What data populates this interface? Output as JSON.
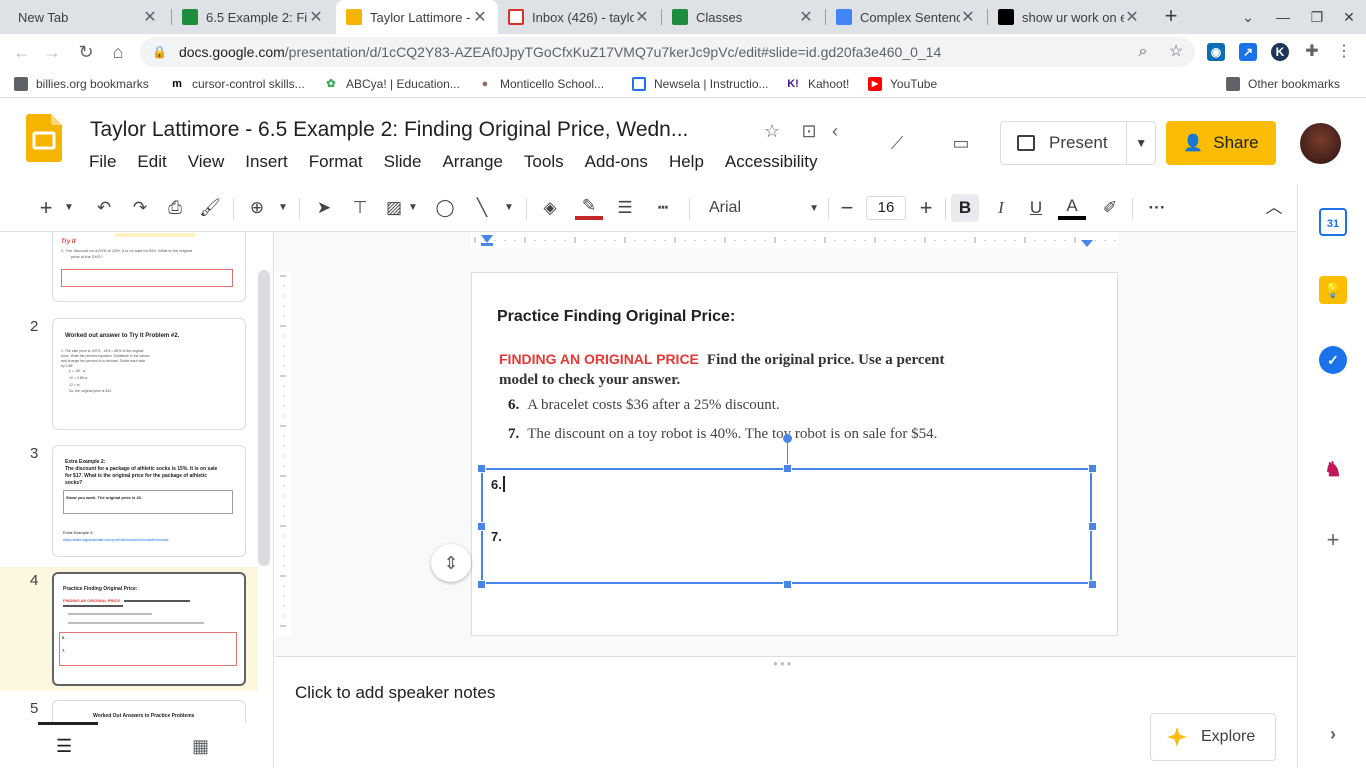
{
  "browser": {
    "tabs": [
      {
        "title": "New Tab",
        "favicon": "new-tab-icon"
      },
      {
        "title": "6.5 Example 2: Fin",
        "favicon": "classroom-icon"
      },
      {
        "title": "Taylor Lattimore -",
        "favicon": "slides-icon",
        "active": true
      },
      {
        "title": "Inbox (426) - taylo",
        "favicon": "gmail-icon"
      },
      {
        "title": "Classes",
        "favicon": "classroom-icon"
      },
      {
        "title": "Complex Sentence",
        "favicon": "docs-icon"
      },
      {
        "title": "show ur work on e",
        "favicon": "brainly-icon"
      }
    ],
    "url_domain": "docs.google.com",
    "url_path": "/presentation/d/1cCQ2Y83-AZEAf0JpyTGoCfxKuZ17VMQ7u7kerJc9pVc/edit#slide=id.gd20fa3e460_0_14",
    "bookmarks": [
      "billies.org bookmarks",
      "cursor-control skills...",
      "ABCya! | Education...",
      "Monticello School...",
      "Newsela | Instructio...",
      "Kahoot!",
      "YouTube"
    ],
    "other_bookmarks": "Other bookmarks"
  },
  "app": {
    "title": "Taylor Lattimore - 6.5 Example 2:  Finding Original Price, Wedn...",
    "menu": [
      "File",
      "Edit",
      "View",
      "Insert",
      "Format",
      "Slide",
      "Arrange",
      "Tools",
      "Add-ons",
      "Help",
      "Accessibility"
    ],
    "present_label": "Present",
    "share_label": "Share",
    "accent_color": "#fbbc04"
  },
  "toolbar": {
    "font_name": "Arial",
    "font_size": "16",
    "bold_active": true
  },
  "filmstrip": {
    "slides": [
      {
        "number": "",
        "line1": "Try It",
        "line2": "2. The discount on a DVD is 15%. It is on sale for $10. What is the original",
        "line3": "price of the DVD?"
      },
      {
        "number": "2",
        "title": "Worked out answer to Try It Problem #2.",
        "body": [
          "2. The sale price is 100% - 15% = 85% of the original",
          "price. Write the percent equation. Substitute in the values",
          "and change the percent to a decimal. Divide each side",
          "by 0.85",
          "p = .85 · w",
          "10 = 0.85 w",
          "12 = w",
          "So, the original price is $12."
        ]
      },
      {
        "number": "3",
        "title": "Extra Example 2:",
        "body": [
          "The discount for a package of athletic socks is 15%. It is on sale",
          "for $17. What is the original price for the package of athletic",
          "socks?"
        ],
        "answer": "Show you work. The original price is 20.",
        "link_label": "Extra Example 2:",
        "link": "https://static.bigideasmath.com/protected/content/ebooks/bimmodel/..."
      },
      {
        "number": "4",
        "title": "Practice Finding Original Price:",
        "selected": true
      },
      {
        "number": "5",
        "title": "Worked Out Answers to Practice Problems"
      }
    ]
  },
  "slide": {
    "title": "Practice Finding Original Price:",
    "red_label": "FINDING AN ORIGINAL PRICE",
    "instruction": "Find the original price. Use a percent model to check your answer.",
    "problems": [
      {
        "num": "6.",
        "text": "A bracelet costs $36 after a 25% discount."
      },
      {
        "num": "7.",
        "text": "The discount on a toy robot is 40%. The toy robot is on sale for $54."
      }
    ],
    "answer_lines": [
      "6.",
      "7."
    ]
  },
  "notes": {
    "placeholder": "Click to add speaker notes"
  },
  "explore_label": "Explore"
}
